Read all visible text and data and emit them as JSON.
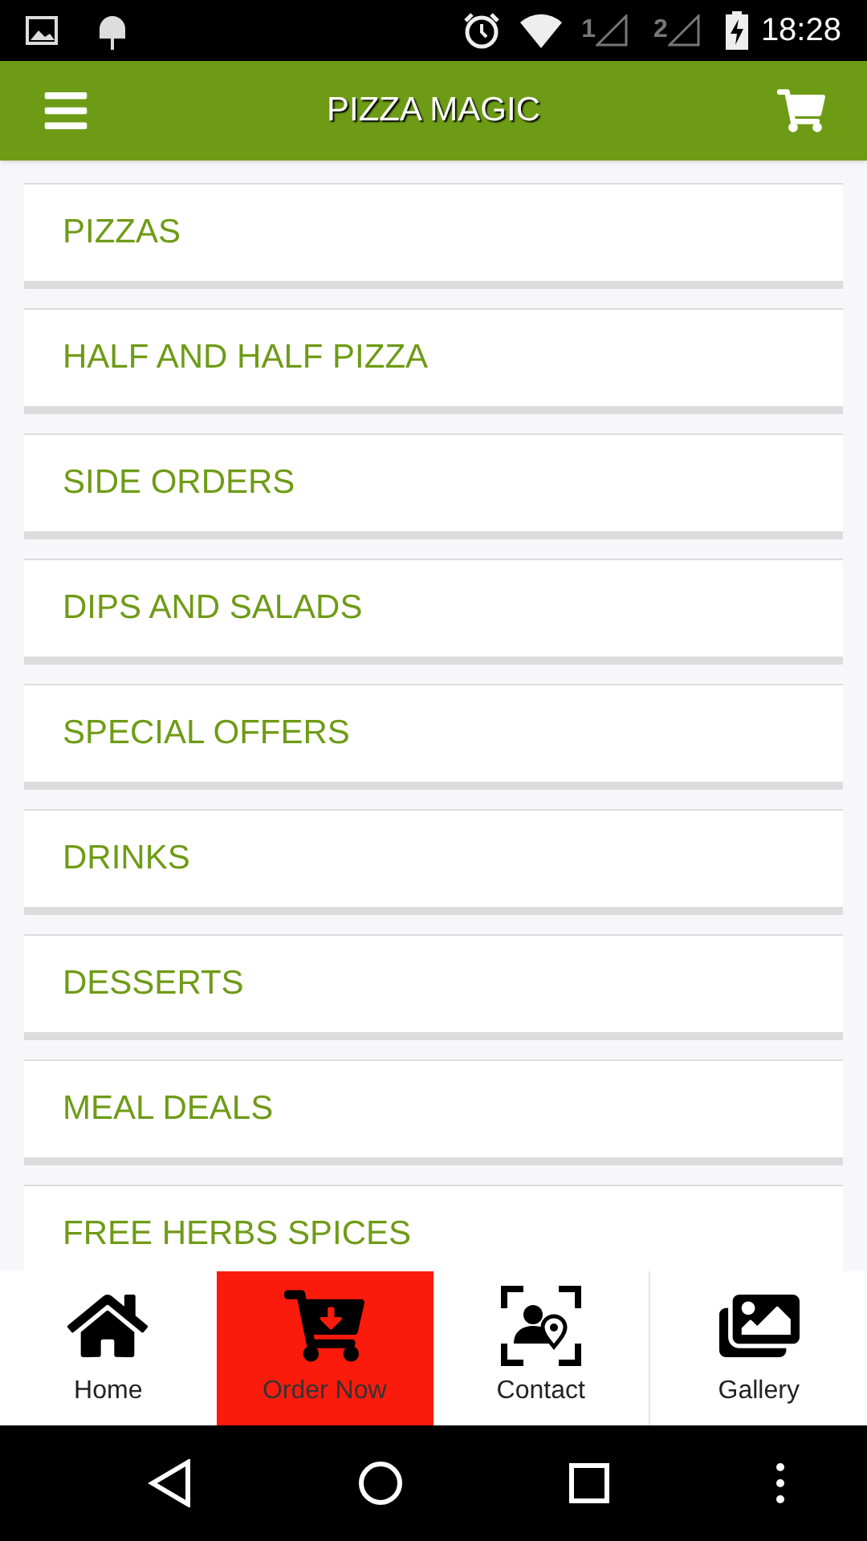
{
  "status_bar": {
    "sim_1": "1",
    "sim_2": "2",
    "time": "18:28"
  },
  "header": {
    "title": "PIZZA MAGIC"
  },
  "categories": [
    {
      "label": "PIZZAS"
    },
    {
      "label": "HALF AND HALF PIZZA"
    },
    {
      "label": "SIDE ORDERS"
    },
    {
      "label": "DIPS AND SALADS"
    },
    {
      "label": "SPECIAL OFFERS"
    },
    {
      "label": "DRINKS"
    },
    {
      "label": "DESSERTS"
    },
    {
      "label": "MEAL DEALS"
    },
    {
      "label": "FREE HERBS SPICES"
    }
  ],
  "bottom_nav": [
    {
      "kind": "home",
      "label": "Home",
      "selected": false
    },
    {
      "kind": "order",
      "label": "Order Now",
      "selected": true
    },
    {
      "kind": "contact",
      "label": "Contact",
      "selected": false
    },
    {
      "kind": "gallery",
      "label": "Gallery",
      "selected": false
    }
  ]
}
